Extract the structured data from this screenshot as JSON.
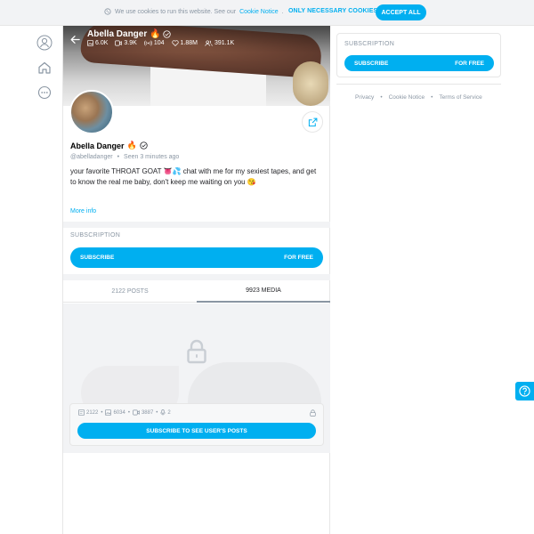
{
  "cookie_bar": {
    "message": "We use cookies to run this website. See our",
    "link": "Cookie Notice",
    "link_suffix": ".",
    "necessary_label": "ONLY NECESSARY COOKIES",
    "accept_label": "ACCEPT ALL"
  },
  "sidebar": {
    "icons": [
      "user-icon",
      "home-icon",
      "more-icon"
    ]
  },
  "profile": {
    "cover_name": "Abella Danger",
    "cover_emoji": "🔥",
    "stats": {
      "photos": "6.0K",
      "videos": "3.9K",
      "streams": "104",
      "likes": "1.88M",
      "fans": "391.1K"
    },
    "name": "Abella Danger",
    "name_emoji": "🔥",
    "handle": "@abelladanger",
    "seen": "Seen  3 minutes ago",
    "bio": "your favorite THROAT GOAT 👅💦 chat with me for my sexiest tapes, and get to know the real me baby, don't keep me waiting on you 😘",
    "more_info": "More info"
  },
  "subscription": {
    "title": "SUBSCRIPTION",
    "button_label": "SUBSCRIBE",
    "button_price": "FOR FREE"
  },
  "tabs": [
    {
      "label": "2122 POSTS",
      "active": false
    },
    {
      "label": "9923 MEDIA",
      "active": true
    }
  ],
  "locked": {
    "posts": "2122",
    "photos": "6034",
    "videos": "3887",
    "audio": "2",
    "button_label": "SUBSCRIBE TO SEE USER'S POSTS"
  },
  "right": {
    "subscription_title": "SUBSCRIPTION",
    "button_label": "SUBSCRIBE",
    "button_price": "FOR FREE",
    "footer_links": [
      "Privacy",
      "Cookie Notice",
      "Terms of Service"
    ]
  },
  "colors": {
    "accent": "#00aff0",
    "muted": "#8a96a3",
    "divider": "#e6e6e6",
    "gray_bg": "#f2f3f5"
  }
}
